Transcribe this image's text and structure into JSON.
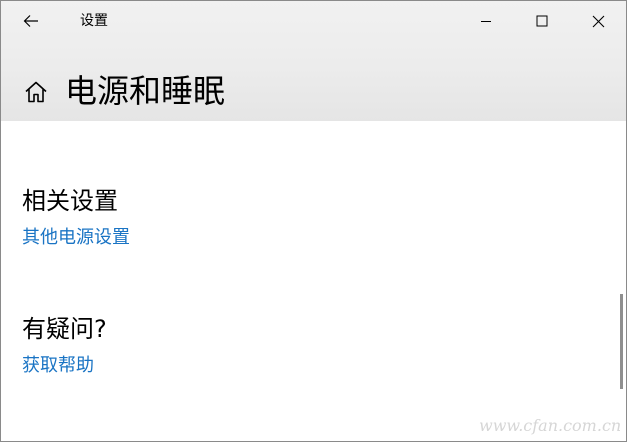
{
  "titlebar": {
    "app_title": "设置",
    "back_icon": "back-arrow-icon",
    "minimize_icon": "minimize-icon",
    "maximize_icon": "maximize-icon",
    "close_icon": "close-icon"
  },
  "header": {
    "home_icon": "home-icon",
    "page_title": "电源和睡眠"
  },
  "related": {
    "title": "相关设置",
    "link_label": "其他电源设置"
  },
  "question": {
    "title": "有疑问?",
    "link_label": "获取帮助"
  },
  "watermark": {
    "text": "www.cfan.com.cn"
  },
  "colors": {
    "link": "#1a74c4",
    "chrome_bg": "#ececec",
    "content_bg": "#ffffff",
    "scrollbar": "#8f8f8f"
  }
}
